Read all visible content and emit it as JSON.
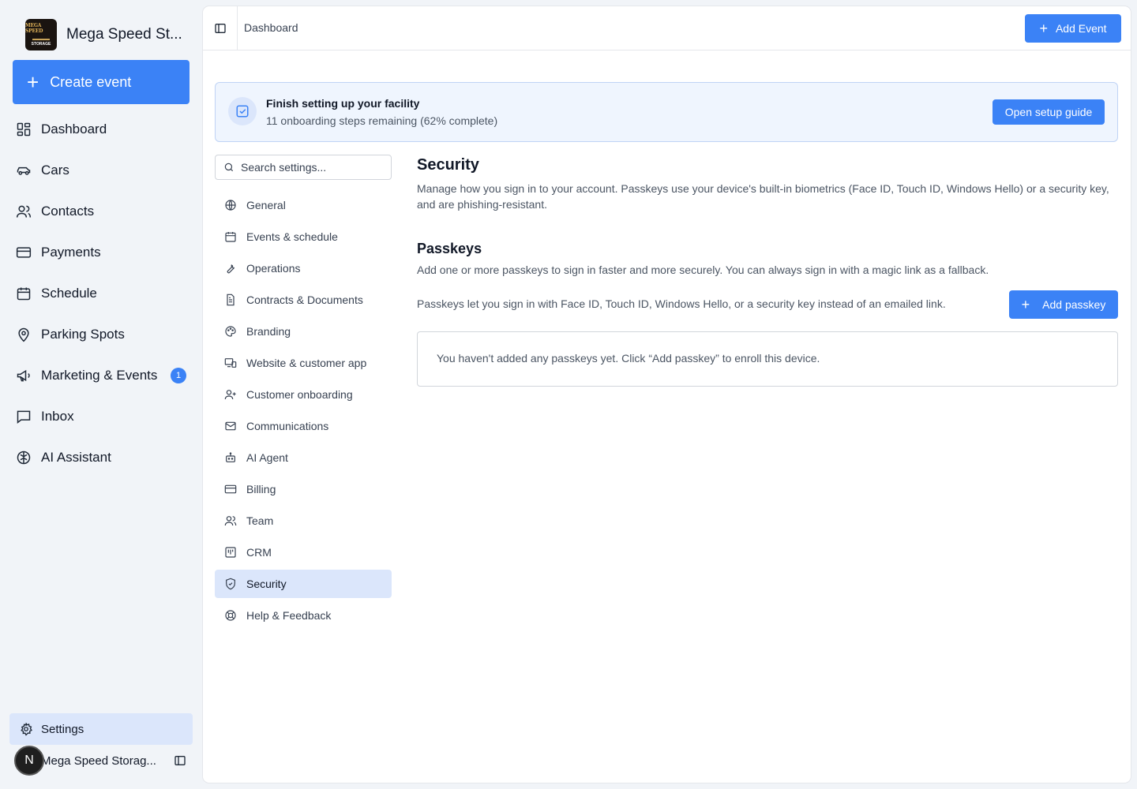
{
  "brand": {
    "name": "Mega Speed St...",
    "logo_line1": "MEGA SPEED",
    "logo_line3": "STORAGE"
  },
  "sidebar": {
    "create_label": "Create event",
    "items": [
      {
        "label": "Dashboard",
        "icon": "dashboard-icon"
      },
      {
        "label": "Cars",
        "icon": "car-icon"
      },
      {
        "label": "Contacts",
        "icon": "users-icon"
      },
      {
        "label": "Payments",
        "icon": "credit-card-icon"
      },
      {
        "label": "Schedule",
        "icon": "calendar-icon"
      },
      {
        "label": "Parking Spots",
        "icon": "map-pin-icon"
      },
      {
        "label": "Marketing & Events",
        "icon": "megaphone-icon",
        "badge": "1"
      },
      {
        "label": "Inbox",
        "icon": "message-square-icon"
      },
      {
        "label": "AI Assistant",
        "icon": "brain-icon"
      }
    ],
    "settings_label": "Settings",
    "account": {
      "avatar_initial": "N",
      "name": "Mega Speed Storag..."
    }
  },
  "topbar": {
    "breadcrumb": "Dashboard",
    "add_event_label": "Add Event"
  },
  "banner": {
    "title": "Finish setting up your facility",
    "subtitle": "11 onboarding steps remaining (62% complete)",
    "button": "Open setup guide"
  },
  "settings_search": {
    "placeholder": "Search settings..."
  },
  "settings_nav": [
    {
      "label": "General",
      "icon": "globe-icon"
    },
    {
      "label": "Events & schedule",
      "icon": "calendar-icon"
    },
    {
      "label": "Operations",
      "icon": "wrench-icon"
    },
    {
      "label": "Contracts & Documents",
      "icon": "file-text-icon"
    },
    {
      "label": "Branding",
      "icon": "palette-icon"
    },
    {
      "label": "Website & customer app",
      "icon": "devices-icon"
    },
    {
      "label": "Customer onboarding",
      "icon": "user-plus-icon"
    },
    {
      "label": "Communications",
      "icon": "mail-icon"
    },
    {
      "label": "AI Agent",
      "icon": "bot-icon"
    },
    {
      "label": "Billing",
      "icon": "credit-card-icon"
    },
    {
      "label": "Team",
      "icon": "users-icon"
    },
    {
      "label": "CRM",
      "icon": "kanban-icon"
    },
    {
      "label": "Security",
      "icon": "shield-icon",
      "active": true
    },
    {
      "label": "Help & Feedback",
      "icon": "life-buoy-icon"
    }
  ],
  "security": {
    "title": "Security",
    "description": "Manage how you sign in to your account. Passkeys use your device's built-in biometrics (Face ID, Touch ID, Windows Hello) or a security key, and are phishing-resistant.",
    "passkeys_title": "Passkeys",
    "passkeys_description": "Add one or more passkeys to sign in faster and more securely. You can always sign in with a magic link as a fallback.",
    "passkeys_note": "Passkeys let you sign in with Face ID, Touch ID, Windows Hello, or a security key instead of an emailed link.",
    "add_passkey_label": "Add passkey",
    "empty_message": "You haven't added any passkeys yet. Click “Add passkey” to enroll this device."
  },
  "colors": {
    "accent": "#3b82f6",
    "active_bg": "#dbe6fb",
    "banner_bg": "#eff5fe"
  }
}
